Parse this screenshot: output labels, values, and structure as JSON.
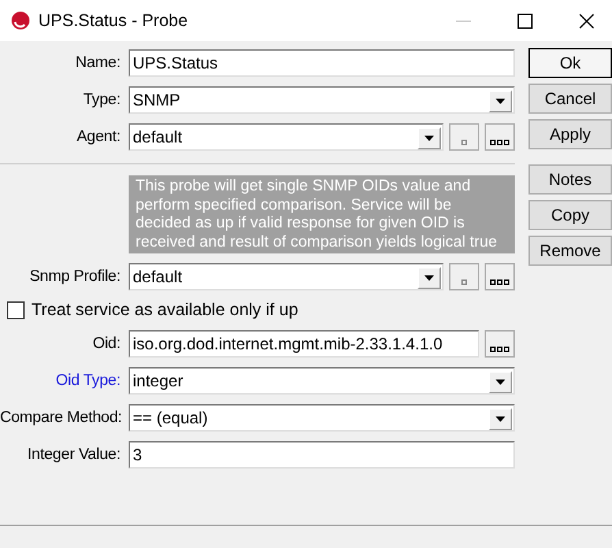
{
  "window": {
    "title": "UPS.Status - Probe"
  },
  "rows": [
    {
      "kind": "text",
      "label": "Name:",
      "label_link": false,
      "value": "UPS.Status"
    },
    {
      "kind": "select",
      "label": "Type:",
      "label_link": false,
      "value": "SNMP"
    },
    {
      "kind": "select_extra",
      "label": "Agent:",
      "label_link": false,
      "value": "default"
    },
    {
      "kind": "separator"
    },
    {
      "kind": "info",
      "text": "This probe will get single SNMP OIDs value and perform specified comparison. Service will be decided as up if valid response for given OID is received and result of comparison yields logical true"
    },
    {
      "kind": "select_extra",
      "label": "Snmp Profile:",
      "label_link": false,
      "value": "default"
    },
    {
      "kind": "checkbox",
      "label": "Treat service as available only if up",
      "checked": false
    },
    {
      "kind": "text_browse",
      "label": "Oid:",
      "label_link": false,
      "value": "iso.org.dod.internet.mgmt.mib-2.33.1.4.1.0"
    },
    {
      "kind": "select",
      "label": "Oid Type:",
      "label_link": true,
      "value": "integer"
    },
    {
      "kind": "select",
      "label": "Compare Method:",
      "label_link": false,
      "value": "== (equal)"
    },
    {
      "kind": "text",
      "label": "Integer Value:",
      "label_link": false,
      "value": "3"
    }
  ],
  "button_groups": [
    [
      {
        "label": "Ok",
        "default": true
      },
      {
        "label": "Cancel",
        "default": false
      },
      {
        "label": "Apply",
        "default": false
      }
    ],
    [
      {
        "label": "Notes",
        "default": false
      },
      {
        "label": "Copy",
        "default": false
      },
      {
        "label": "Remove",
        "default": false
      }
    ]
  ]
}
